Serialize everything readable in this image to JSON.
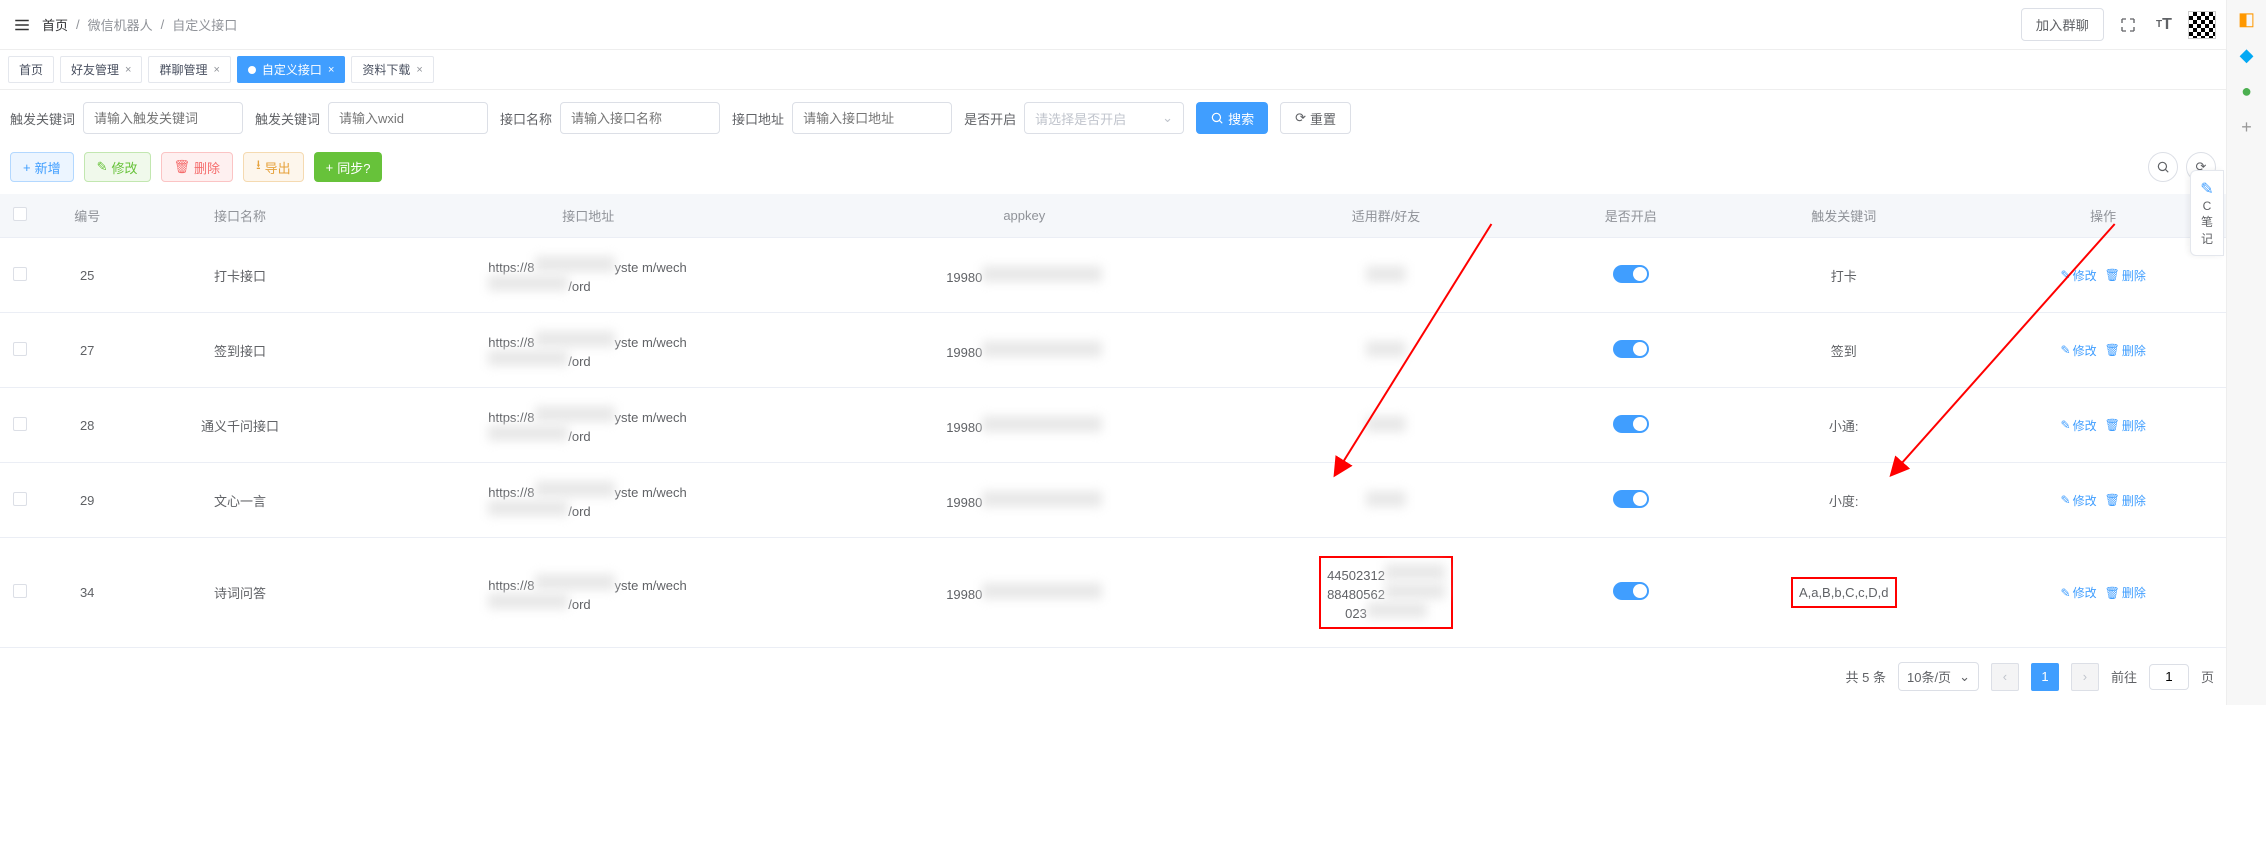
{
  "breadcrumb": {
    "home": "首页",
    "l1": "微信机器人",
    "l2": "自定义接口"
  },
  "topbar": {
    "join_group": "加入群聊"
  },
  "tabs": [
    {
      "label": "首页",
      "closable": false,
      "active": false
    },
    {
      "label": "好友管理",
      "closable": true,
      "active": false
    },
    {
      "label": "群聊管理",
      "closable": true,
      "active": false
    },
    {
      "label": "自定义接口",
      "closable": true,
      "active": true
    },
    {
      "label": "资料下载",
      "closable": true,
      "active": false
    }
  ],
  "search": {
    "f1": {
      "label": "触发关键词",
      "placeholder": "请输入触发关键词"
    },
    "f2": {
      "label": "触发关键词",
      "placeholder": "请输入wxid"
    },
    "f3": {
      "label": "接口名称",
      "placeholder": "请输入接口名称"
    },
    "f4": {
      "label": "接口地址",
      "placeholder": "请输入接口地址"
    },
    "f5": {
      "label": "是否开启",
      "placeholder": "请选择是否开启"
    },
    "search_btn": "搜索",
    "reset_btn": "重置"
  },
  "actions": {
    "add": "新增",
    "edit": "修改",
    "delete": "删除",
    "export": "导出",
    "sync": "同步?"
  },
  "table": {
    "headers": {
      "id": "编号",
      "name": "接口名称",
      "url": "接口地址",
      "appkey": "appkey",
      "target": "适用群/好友",
      "enabled": "是否开启",
      "keyword": "触发关键词",
      "ops": "操作"
    },
    "ops": {
      "edit": "修改",
      "delete": "删除"
    },
    "rows": [
      {
        "id": "25",
        "name": "打卡接口",
        "url_pre": "https://8",
        "url_mid": "yste m/wech",
        "url_post": "/ord",
        "appkey_pre": "19980",
        "target": "",
        "enabled": true,
        "keyword": "打卡"
      },
      {
        "id": "27",
        "name": "签到接口",
        "url_pre": "https://8",
        "url_mid": "yste m/wech",
        "url_post": "/ord",
        "appkey_pre": "19980",
        "target": "",
        "enabled": true,
        "keyword": "签到"
      },
      {
        "id": "28",
        "name": "通义千问接口",
        "url_pre": "https://8",
        "url_mid": "yste m/wech",
        "url_post": "/ord",
        "appkey_pre": "19980",
        "target": "",
        "enabled": true,
        "keyword": "小通:"
      },
      {
        "id": "29",
        "name": "文心一言",
        "url_pre": "https://8",
        "url_mid": "yste m/wech",
        "url_post": "/ord",
        "appkey_pre": "19980",
        "target": "",
        "enabled": true,
        "keyword": "小度:"
      },
      {
        "id": "34",
        "name": "诗词问答",
        "url_pre": "https://8",
        "url_mid": "yste m/wech",
        "url_post": "/ord",
        "appkey_pre": "19980",
        "target": "44502312    88480562    023",
        "enabled": true,
        "keyword": "A,a,B,b,C,c,D,d",
        "boxed": true
      }
    ]
  },
  "pagination": {
    "total": "共 5 条",
    "page_size": "10条/页",
    "current": "1",
    "goto_label": "前往",
    "goto_value": "1",
    "page_unit": "页"
  },
  "side_widget": {
    "line1": "C",
    "line2": "笔",
    "line3": "记"
  }
}
